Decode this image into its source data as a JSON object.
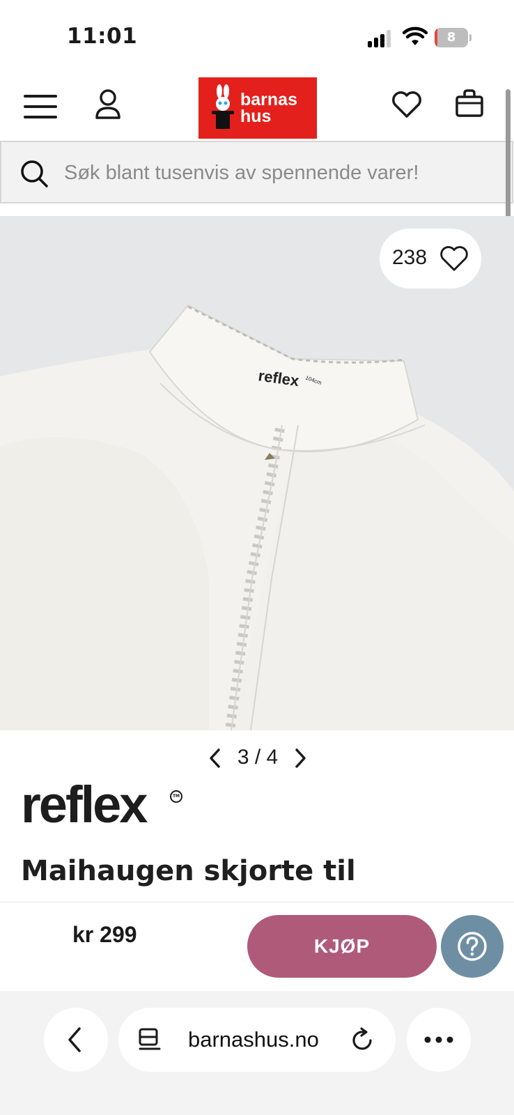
{
  "status_bar": {
    "time": "11:01",
    "battery": "8",
    "battery_fraction": 0.08
  },
  "header": {
    "logo_text_line1": "barnas",
    "logo_text_line2": "hus"
  },
  "search": {
    "placeholder": "Søk blant tusenvis av spennende varer!"
  },
  "product": {
    "likes": "238",
    "pager": "3 / 4",
    "brand": "reflex",
    "brand_mark": "TM",
    "title": "Maihaugen skjorte til"
  },
  "buy_bar": {
    "price": "kr 299",
    "buy_label": "KJØP"
  },
  "browser": {
    "url": "barnashus.no"
  },
  "colors": {
    "logo_red": "#e3201b",
    "buy_button": "#b05a7a",
    "help_button": "#6e8fa3"
  },
  "icons": [
    "menu-icon",
    "user-icon",
    "heart-icon",
    "bag-icon",
    "search-icon",
    "chevron-left-icon",
    "chevron-right-icon",
    "help-icon",
    "reader-icon",
    "reload-icon",
    "more-icon"
  ]
}
